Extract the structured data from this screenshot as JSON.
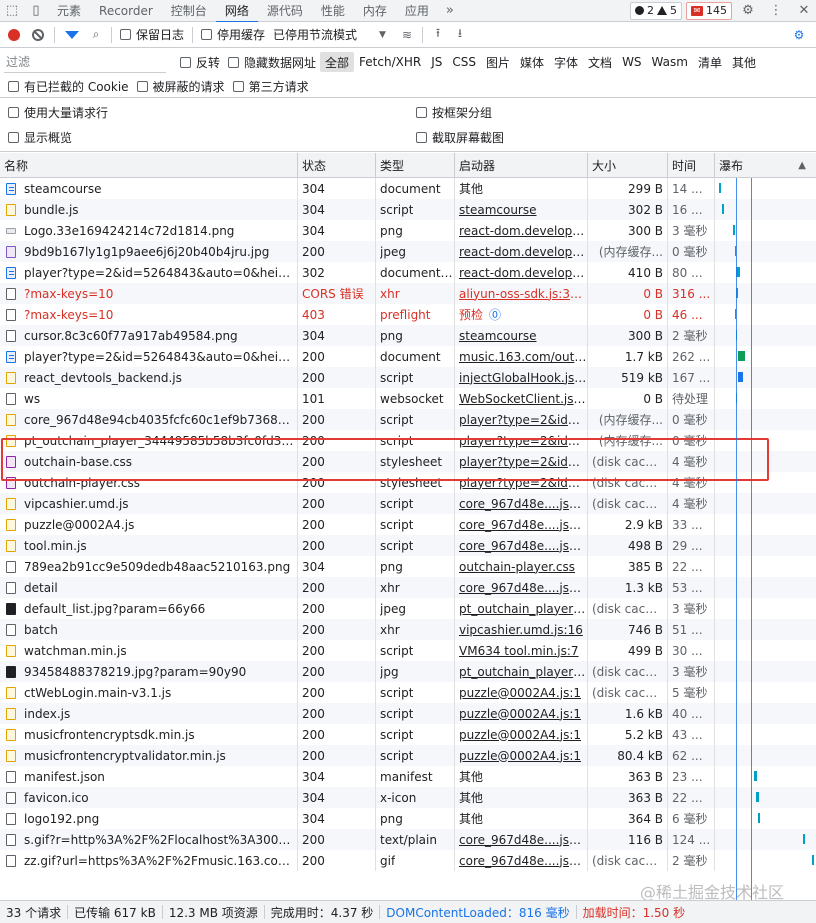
{
  "tabs": [
    "元素",
    "Recorder",
    "控制台",
    "网络",
    "源代码",
    "性能",
    "内存",
    "应用"
  ],
  "tabs_active": "网络",
  "tab_more": "»",
  "badge_errors": "2",
  "badge_warnings": "5",
  "badge_issues": "145",
  "toolbar": {
    "preserve_log": "保留日志",
    "disable_cache": "停用缓存",
    "throttle": "已停用节流模式"
  },
  "filter": {
    "placeholder": "过滤",
    "invert": "反转",
    "hide_data_urls": "隐藏数据网址",
    "types": [
      "全部",
      "Fetch/XHR",
      "JS",
      "CSS",
      "图片",
      "媒体",
      "字体",
      "文档",
      "WS",
      "Wasm",
      "清单",
      "其他"
    ]
  },
  "blocked": {
    "cookies": "有已拦截的 Cookie",
    "requests": "被屏蔽的请求",
    "third_party": "第三方请求"
  },
  "settings": {
    "big_rows": "使用大量请求行",
    "overview": "显示概览",
    "group_by_frame": "按框架分组",
    "capture_screenshots": "截取屏幕截图"
  },
  "columns": [
    "名称",
    "状态",
    "类型",
    "启动器",
    "大小",
    "时间",
    "瀑布"
  ],
  "waterfall_sort": "▲",
  "rows": [
    {
      "icon": "doc",
      "name": "steamcourse",
      "status": "304",
      "type": "document",
      "initiator": "其他",
      "size": "299 B",
      "time": "14 ..."
    },
    {
      "icon": "script",
      "name": "bundle.js",
      "status": "304",
      "type": "script",
      "initiator": "steamcourse",
      "size": "302 B",
      "time": "16 ..."
    },
    {
      "icon": "logo",
      "name": "Logo.33e169424214c72d1814.png",
      "status": "304",
      "type": "png",
      "initiator": "react-dom.developm...",
      "size": "300 B",
      "time": "3 毫秒"
    },
    {
      "icon": "img",
      "name": "9bd9b167ly1g1p9aee6j6j20b40b4jru.jpg",
      "status": "200",
      "type": "jpeg",
      "initiator": "react-dom.developm...",
      "size": "(内存缓存...",
      "time": "0 毫秒"
    },
    {
      "icon": "doc",
      "name": "player?type=2&id=5264843&auto=0&height=66",
      "status": "302",
      "type": "document ...",
      "initiator": "react-dom.developm...",
      "size": "410 B",
      "time": "80 ..."
    },
    {
      "icon": "fetch",
      "name": "?max-keys=10",
      "status": "CORS 错误",
      "type": "xhr",
      "initiator": "aliyun-oss-sdk.js:34391",
      "size": "0 B",
      "time": "316 ...",
      "error": true
    },
    {
      "icon": "fetch",
      "name": "?max-keys=10",
      "status": "403",
      "type": "preflight",
      "initiator": "预检",
      "size": "0 B",
      "time": "46 ...",
      "error": true,
      "preflight": true
    },
    {
      "icon": "plain",
      "name": "cursor.8c3c60f77a917ab49584.png",
      "status": "304",
      "type": "png",
      "initiator": "steamcourse",
      "size": "300 B",
      "time": "2 毫秒"
    },
    {
      "icon": "doc",
      "name": "player?type=2&id=5264843&auto=0&height=66",
      "status": "200",
      "type": "document",
      "initiator": "music.163.com/outch...",
      "size": "1.7 kB",
      "time": "262 ..."
    },
    {
      "icon": "script",
      "name": "react_devtools_backend.js",
      "status": "200",
      "type": "script",
      "initiator": "injectGlobalHook.js:2...",
      "size": "519 kB",
      "time": "167 ..."
    },
    {
      "icon": "plain",
      "name": "ws",
      "status": "101",
      "type": "websocket",
      "initiator": "WebSocketClient.js:16",
      "size": "0 B",
      "time": "待处理"
    },
    {
      "icon": "script",
      "name": "core_967d48e94cb4035fcfc60c1ef9b7368e.js?967...",
      "status": "200",
      "type": "script",
      "initiator": "player?type=2&id=5...",
      "size": "(内存缓存...",
      "time": "0 毫秒"
    },
    {
      "icon": "script",
      "name": "pt_outchain_player_34449585b58b3fc0fd313085...",
      "status": "200",
      "type": "script",
      "initiator": "player?type=2&id=5...",
      "size": "(内存缓存...",
      "time": "0 毫秒"
    },
    {
      "icon": "style",
      "name": "outchain-base.css",
      "status": "200",
      "type": "stylesheet",
      "initiator": "player?type=2&id=5...",
      "size": "(disk cache)",
      "time": "4 毫秒"
    },
    {
      "icon": "style",
      "name": "outchain-player.css",
      "status": "200",
      "type": "stylesheet",
      "initiator": "player?type=2&id=5...",
      "size": "(disk cache)",
      "time": "4 毫秒"
    },
    {
      "icon": "script",
      "name": "vipcashier.umd.js",
      "status": "200",
      "type": "script",
      "initiator": "core_967d48e....js?96...",
      "size": "(disk cache)",
      "time": "4 毫秒"
    },
    {
      "icon": "script",
      "name": "puzzle@0002A4.js",
      "status": "200",
      "type": "script",
      "initiator": "core_967d48e....js?96...",
      "size": "2.9 kB",
      "time": "33 ..."
    },
    {
      "icon": "script",
      "name": "tool.min.js",
      "status": "200",
      "type": "script",
      "initiator": "core_967d48e....js?96...",
      "size": "498 B",
      "time": "29 ..."
    },
    {
      "icon": "plain",
      "name": "789ea2b91cc9e509dedb48aac5210163.png",
      "status": "304",
      "type": "png",
      "initiator": "outchain-player.css",
      "size": "385 B",
      "time": "22 ..."
    },
    {
      "icon": "fetch",
      "name": "detail",
      "status": "200",
      "type": "xhr",
      "initiator": "core_967d48e....js?96...",
      "size": "1.3 kB",
      "time": "53 ..."
    },
    {
      "icon": "dark",
      "name": "default_list.jpg?param=66y66",
      "status": "200",
      "type": "jpeg",
      "initiator": "pt_outchain_player_3...",
      "size": "(disk cache)",
      "time": "3 毫秒"
    },
    {
      "icon": "fetch",
      "name": "batch",
      "status": "200",
      "type": "xhr",
      "initiator": "vipcashier.umd.js:16",
      "size": "746 B",
      "time": "51 ..."
    },
    {
      "icon": "script",
      "name": "watchman.min.js",
      "status": "200",
      "type": "script",
      "initiator": "VM634 tool.min.js:7",
      "size": "499 B",
      "time": "30 ..."
    },
    {
      "icon": "dark",
      "name": "93458488378219.jpg?param=90y90",
      "status": "200",
      "type": "jpg",
      "initiator": "pt_outchain_player_3...",
      "size": "(disk cache)",
      "time": "3 毫秒"
    },
    {
      "icon": "script",
      "name": "ctWebLogin.main-v3.1.js",
      "status": "200",
      "type": "script",
      "initiator": "puzzle@0002A4.js:1",
      "size": "(disk cache)",
      "time": "5 毫秒"
    },
    {
      "icon": "script",
      "name": "index.js",
      "status": "200",
      "type": "script",
      "initiator": "puzzle@0002A4.js:1",
      "size": "1.6 kB",
      "time": "40 ..."
    },
    {
      "icon": "script",
      "name": "musicfrontencryptsdk.min.js",
      "status": "200",
      "type": "script",
      "initiator": "puzzle@0002A4.js:1",
      "size": "5.2 kB",
      "time": "43 ..."
    },
    {
      "icon": "script",
      "name": "musicfrontencryptvalidator.min.js",
      "status": "200",
      "type": "script",
      "initiator": "puzzle@0002A4.js:1",
      "size": "80.4 kB",
      "time": "62 ..."
    },
    {
      "icon": "plain",
      "name": "manifest.json",
      "status": "304",
      "type": "manifest",
      "initiator": "其他",
      "size": "363 B",
      "time": "23 ..."
    },
    {
      "icon": "plain",
      "name": "favicon.ico",
      "status": "304",
      "type": "x-icon",
      "initiator": "其他",
      "size": "363 B",
      "time": "22 ..."
    },
    {
      "icon": "plain",
      "name": "logo192.png",
      "status": "304",
      "type": "png",
      "initiator": "其他",
      "size": "364 B",
      "time": "6 毫秒"
    },
    {
      "icon": "plain",
      "name": "s.gif?r=http%3A%2F%2Flocalhost%3A3000%2F&...",
      "status": "200",
      "type": "text/plain",
      "initiator": "core_967d48e....js?96...",
      "size": "116 B",
      "time": "124 ..."
    },
    {
      "icon": "plain",
      "name": "zz.gif?url=https%3A%2F%2Fmusic.163.com%2Fo...",
      "status": "200",
      "type": "gif",
      "initiator": "core_967d48e....js?96...",
      "size": "(disk cache)",
      "time": "2 毫秒"
    }
  ],
  "status": {
    "requests": "33 个请求",
    "transferred": "已传输 617 kB",
    "resources": "12.3 MB 项资源",
    "finish": "完成用时：4.37 秒",
    "dcl": "DOMContentLoaded：816 毫秒",
    "load": "加载时间：1.50 秒"
  },
  "colors": {
    "accent": "#1a73e8",
    "error": "#d93025",
    "dcl": "#1a73e8",
    "load": "#d93025"
  },
  "watermark": "@稀土掘金技术社区"
}
